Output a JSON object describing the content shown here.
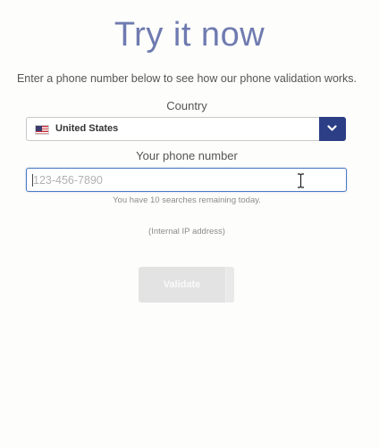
{
  "header": {
    "title": "Try it now",
    "subtitle": "Enter a phone number below to see how our phone validation works."
  },
  "country": {
    "label": "Country",
    "selected": "United States",
    "flag_icon": "us-flag-icon",
    "dropdown_icon": "chevron-down-icon"
  },
  "phone": {
    "label": "Your phone number",
    "placeholder": "123-456-7890",
    "value": ""
  },
  "info": {
    "remaining": "You have 10 searches remaining today.",
    "ip": "(Internal IP address)"
  },
  "actions": {
    "validate_label": "Validate"
  },
  "colors": {
    "title": "#6f7bb0",
    "dropdown_button": "#2c3e86",
    "input_focus_border": "#4a78c5",
    "validate_disabled_bg": "#e3e3e3"
  }
}
